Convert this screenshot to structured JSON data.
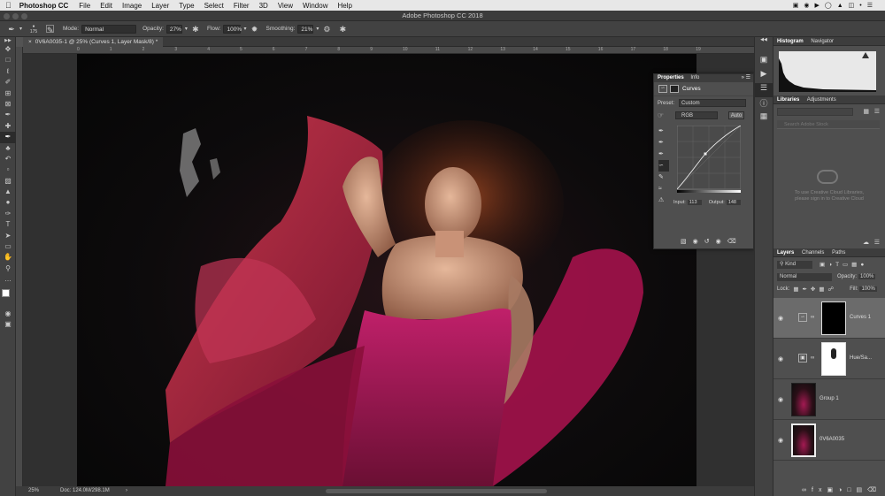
{
  "menubar": {
    "app": "Photoshop CC",
    "items": [
      "File",
      "Edit",
      "Image",
      "Layer",
      "Type",
      "Select",
      "Filter",
      "3D",
      "View",
      "Window",
      "Help"
    ]
  },
  "window": {
    "title": "Adobe Photoshop CC 2018"
  },
  "options": {
    "brush_size": "175",
    "mode_label": "Mode:",
    "mode_value": "Normal",
    "opacity_label": "Opacity:",
    "opacity_value": "27%",
    "flow_label": "Flow:",
    "flow_value": "100%",
    "smoothing_label": "Smoothing:",
    "smoothing_value": "21%"
  },
  "document": {
    "tab_title": "0V6A0035-1 @ 25% (Curves 1, Layer Mask/8) *"
  },
  "rulers": {
    "top_ticks": [
      "0",
      "1",
      "2",
      "3",
      "4",
      "5",
      "6",
      "7",
      "8",
      "9",
      "10",
      "11",
      "12",
      "13",
      "14",
      "15",
      "16",
      "17",
      "18",
      "19"
    ]
  },
  "status": {
    "zoom": "25%",
    "doc": "Doc: 124.0M/298.1M"
  },
  "properties": {
    "tabs": [
      "Properties",
      "Info"
    ],
    "title": "Curves",
    "preset_label": "Preset:",
    "preset_value": "Custom",
    "channel_value": "RGB",
    "auto_label": "Auto",
    "input_label": "Input:",
    "input_value": "113",
    "output_label": "Output:",
    "output_value": "148"
  },
  "histogram": {
    "tabs": [
      "Histogram",
      "Navigator"
    ]
  },
  "libraries": {
    "tabs": [
      "Libraries",
      "Adjustments"
    ],
    "search_placeholder": "Search Adobe Stock",
    "message": "To use Creative Cloud Libraries, please sign in to Creative Cloud"
  },
  "layers_panel": {
    "tabs": [
      "Layers",
      "Channels",
      "Paths"
    ],
    "kind_value": "Kind",
    "blend_value": "Normal",
    "opacity_label": "Opacity:",
    "opacity_value": "100%",
    "lock_label": "Lock:",
    "fill_label": "Fill:",
    "fill_value": "100%",
    "layers": [
      {
        "name": "Curves 1"
      },
      {
        "name": "Hue/Sa..."
      },
      {
        "name": "Group 1"
      },
      {
        "name": "0V6A0035"
      }
    ]
  },
  "colors": {
    "panel": "#4f4f4f",
    "dark": "#3d3d3d",
    "selected_layer": "#6b6b6b",
    "dress": "#a8154e"
  }
}
